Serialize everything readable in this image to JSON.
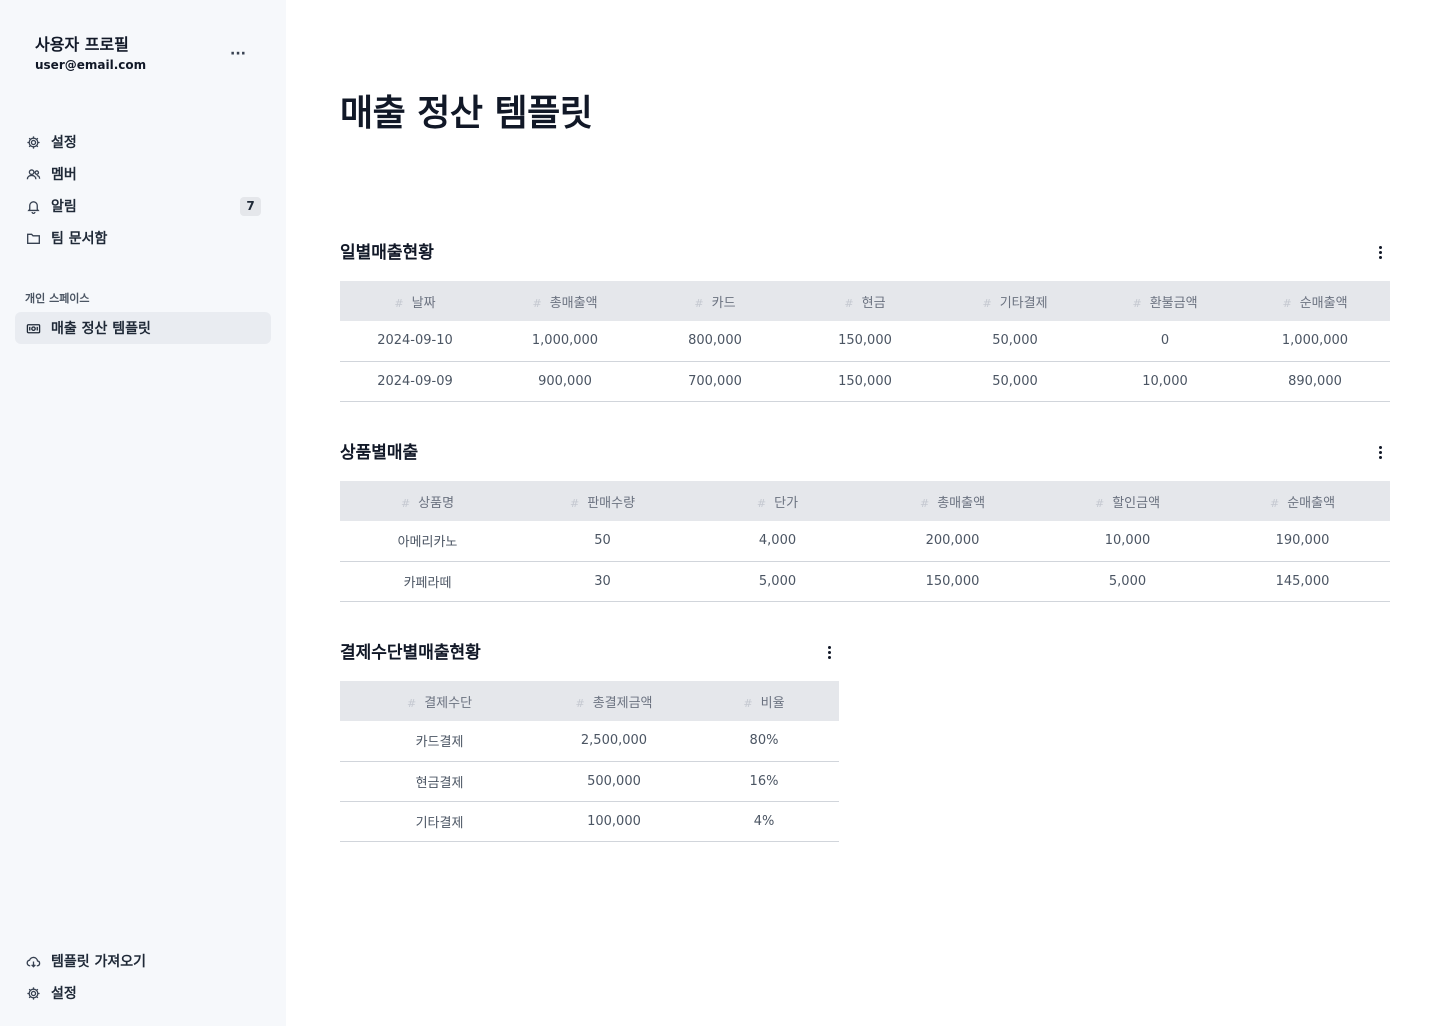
{
  "sidebar": {
    "profile_name": "사용자 프로필",
    "profile_email": "user@email.com",
    "more_label": "···",
    "items": [
      {
        "label": "설정",
        "icon": "gear-icon"
      },
      {
        "label": "멤버",
        "icon": "users-icon"
      },
      {
        "label": "알림",
        "icon": "bell-icon",
        "badge": "7"
      },
      {
        "label": "팀 문서함",
        "icon": "folder-icon"
      }
    ],
    "personal_space_label": "개인 스페이스",
    "personal_items": [
      {
        "label": "매출 정산 템플릿",
        "icon": "money-icon"
      }
    ],
    "bottom_items": [
      {
        "label": "템플릿 가져오기",
        "icon": "cloud-download-icon"
      },
      {
        "label": "설정",
        "icon": "gear-icon"
      }
    ]
  },
  "page": {
    "title": "매출 정산 템플릿"
  },
  "tables": {
    "daily": {
      "title": "일별매출현황",
      "columns": [
        "날짜",
        "총매출액",
        "카드",
        "현금",
        "기타결제",
        "환불금액",
        "순매출액"
      ],
      "rows": [
        [
          "2024-09-10",
          "1,000,000",
          "800,000",
          "150,000",
          "50,000",
          "0",
          "1,000,000"
        ],
        [
          "2024-09-09",
          "900,000",
          "700,000",
          "150,000",
          "50,000",
          "10,000",
          "890,000"
        ]
      ]
    },
    "product": {
      "title": "상품별매출",
      "columns": [
        "상품명",
        "판매수량",
        "단가",
        "총매출액",
        "할인금액",
        "순매출액"
      ],
      "rows": [
        [
          "아메리카노",
          "50",
          "4,000",
          "200,000",
          "10,000",
          "190,000"
        ],
        [
          "카페라떼",
          "30",
          "5,000",
          "150,000",
          "5,000",
          "145,000"
        ]
      ]
    },
    "payment": {
      "title": "결제수단별매출현황",
      "columns": [
        "결제수단",
        "총결제금액",
        "비율"
      ],
      "rows": [
        [
          "카드결제",
          "2,500,000",
          "80%"
        ],
        [
          "현금결제",
          "500,000",
          "16%"
        ],
        [
          "기타결제",
          "100,000",
          "4%"
        ]
      ]
    }
  },
  "colors": {
    "sidebar_bg": "#f6f8fb",
    "header_bg": "#e5e7eb",
    "active_item_bg": "#e9ecf1"
  }
}
